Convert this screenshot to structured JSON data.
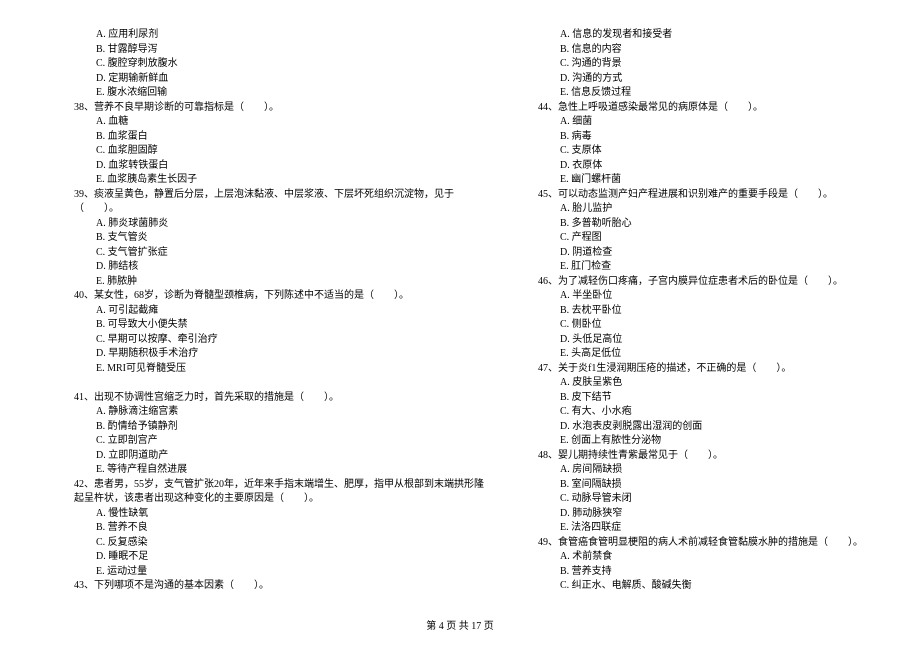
{
  "footer": "第 4 页 共 17 页",
  "left": [
    {
      "cls": "opt",
      "t": "A. 应用利尿剂"
    },
    {
      "cls": "opt",
      "t": "B. 甘露醇导泻"
    },
    {
      "cls": "opt",
      "t": "C. 腹腔穿刺放腹水"
    },
    {
      "cls": "opt",
      "t": "D. 定期输新鲜血"
    },
    {
      "cls": "opt",
      "t": "E. 腹水浓缩回输"
    },
    {
      "cls": "q",
      "t": "38、营养不良早期诊断的可靠指标是（　　）。"
    },
    {
      "cls": "opt",
      "t": "A. 血糖"
    },
    {
      "cls": "opt",
      "t": "B. 血浆蛋白"
    },
    {
      "cls": "opt",
      "t": "C. 血浆胆固醇"
    },
    {
      "cls": "opt",
      "t": "D. 血浆转铁蛋白"
    },
    {
      "cls": "opt",
      "t": "E. 血浆胰岛素生长因子"
    },
    {
      "cls": "q",
      "t": "39、痰液呈黄色，静置后分层，上层泡沫黏液、中层浆液、下层坏死组织沉淀物，见于"
    },
    {
      "cls": "q-cont",
      "t": "（　　）。"
    },
    {
      "cls": "opt",
      "t": "A. 肺炎球菌肺炎"
    },
    {
      "cls": "opt",
      "t": "B. 支气管炎"
    },
    {
      "cls": "opt",
      "t": "C. 支气管扩张症"
    },
    {
      "cls": "opt",
      "t": "D. 肺结核"
    },
    {
      "cls": "opt",
      "t": "E. 肺脓肿"
    },
    {
      "cls": "q",
      "t": "40、某女性，68岁，诊断为脊髓型颈椎病，下列陈述中不适当的是（　　）。"
    },
    {
      "cls": "opt",
      "t": "A. 可引起截瘫"
    },
    {
      "cls": "opt",
      "t": "B. 可导致大小便失禁"
    },
    {
      "cls": "opt",
      "t": "C. 早期可以按摩、牵引治疗"
    },
    {
      "cls": "opt",
      "t": "D. 早期随积极手术治疗"
    },
    {
      "cls": "opt",
      "t": "E. MRI可见脊髓受压"
    },
    {
      "cls": "q",
      "t": "　"
    },
    {
      "cls": "q",
      "t": "41、出现不协调性宫缩乏力时，首先采取的措施是（　　）。"
    },
    {
      "cls": "opt",
      "t": "A. 静脉滴注缩宫素"
    },
    {
      "cls": "opt",
      "t": "B. 酌情给予镇静剂"
    },
    {
      "cls": "opt",
      "t": "C. 立即剖宫产"
    },
    {
      "cls": "opt",
      "t": "D. 立即阴道助产"
    },
    {
      "cls": "opt",
      "t": "E. 等待产程自然进展"
    },
    {
      "cls": "q",
      "t": "42、患者男，55岁，支气管扩张20年，近年来手指末端增生、肥厚，指甲从根部到末端拱形隆"
    },
    {
      "cls": "q-cont",
      "t": "起呈杵状，该患者出现这种变化的主要原因是（　　）。"
    },
    {
      "cls": "opt",
      "t": "A. 慢性缺氧"
    },
    {
      "cls": "opt",
      "t": "B. 营养不良"
    },
    {
      "cls": "opt",
      "t": "C. 反复感染"
    },
    {
      "cls": "opt",
      "t": "D. 睡眠不足"
    },
    {
      "cls": "opt",
      "t": "E. 运动过量"
    },
    {
      "cls": "q",
      "t": "43、下列哪项不是沟通的基本因素（　　）。"
    }
  ],
  "right": [
    {
      "cls": "opt",
      "t": "A. 信息的发现者和接受者"
    },
    {
      "cls": "opt",
      "t": "B. 信息的内容"
    },
    {
      "cls": "opt",
      "t": "C. 沟通的背景"
    },
    {
      "cls": "opt",
      "t": "D. 沟通的方式"
    },
    {
      "cls": "opt",
      "t": "E. 信息反馈过程"
    },
    {
      "cls": "q",
      "t": "44、急性上呼吸道感染最常见的病原体是（　　）。"
    },
    {
      "cls": "opt",
      "t": "A. 细菌"
    },
    {
      "cls": "opt",
      "t": "B. 病毒"
    },
    {
      "cls": "opt",
      "t": "C. 支原体"
    },
    {
      "cls": "opt",
      "t": "D. 衣原体"
    },
    {
      "cls": "opt",
      "t": "E. 幽门螺杆菌"
    },
    {
      "cls": "q",
      "t": "45、可以动态监测产妇产程进展和识别难产的重要手段是（　　）。"
    },
    {
      "cls": "opt",
      "t": "A. 胎儿监护"
    },
    {
      "cls": "opt",
      "t": "B. 多普勒听胎心"
    },
    {
      "cls": "opt",
      "t": "C. 产程图"
    },
    {
      "cls": "opt",
      "t": "D. 阴道检查"
    },
    {
      "cls": "opt",
      "t": "E. 肛门检查"
    },
    {
      "cls": "q",
      "t": "46、为了减轻伤口疼痛，子宫内膜异位症患者术后的卧位是（　　）。"
    },
    {
      "cls": "opt",
      "t": "A. 半坐卧位"
    },
    {
      "cls": "opt",
      "t": "B. 去枕平卧位"
    },
    {
      "cls": "opt",
      "t": "C. 侧卧位"
    },
    {
      "cls": "opt",
      "t": "D. 头低足高位"
    },
    {
      "cls": "opt",
      "t": "E. 头高足低位"
    },
    {
      "cls": "q",
      "t": "47、关于炎f1生浸润期压疮的描述，不正确的是（　　）。"
    },
    {
      "cls": "opt",
      "t": "A. 皮肤呈紫色"
    },
    {
      "cls": "opt",
      "t": "B. 皮下结节"
    },
    {
      "cls": "opt",
      "t": "C. 有大、小水疱"
    },
    {
      "cls": "opt",
      "t": "D. 水泡表皮剥脱露出湿润的创面"
    },
    {
      "cls": "opt",
      "t": "E. 创面上有脓性分泌物"
    },
    {
      "cls": "q",
      "t": "48、婴儿期持续性青紫最常见于（　　）。"
    },
    {
      "cls": "opt",
      "t": "A. 房间隔缺损"
    },
    {
      "cls": "opt",
      "t": "B. 室间隔缺损"
    },
    {
      "cls": "opt",
      "t": "C. 动脉导管未闭"
    },
    {
      "cls": "opt",
      "t": "D. 肺动脉狭窄"
    },
    {
      "cls": "opt",
      "t": "E. 法洛四联症"
    },
    {
      "cls": "q",
      "t": "49、食管癌食管明显梗阻的病人术前减轻食管黏膜水肿的措施是（　　）。"
    },
    {
      "cls": "opt",
      "t": "A. 术前禁食"
    },
    {
      "cls": "opt",
      "t": "B. 营养支持"
    },
    {
      "cls": "opt",
      "t": "C. 纠正水、电解质、酸碱失衡"
    }
  ]
}
